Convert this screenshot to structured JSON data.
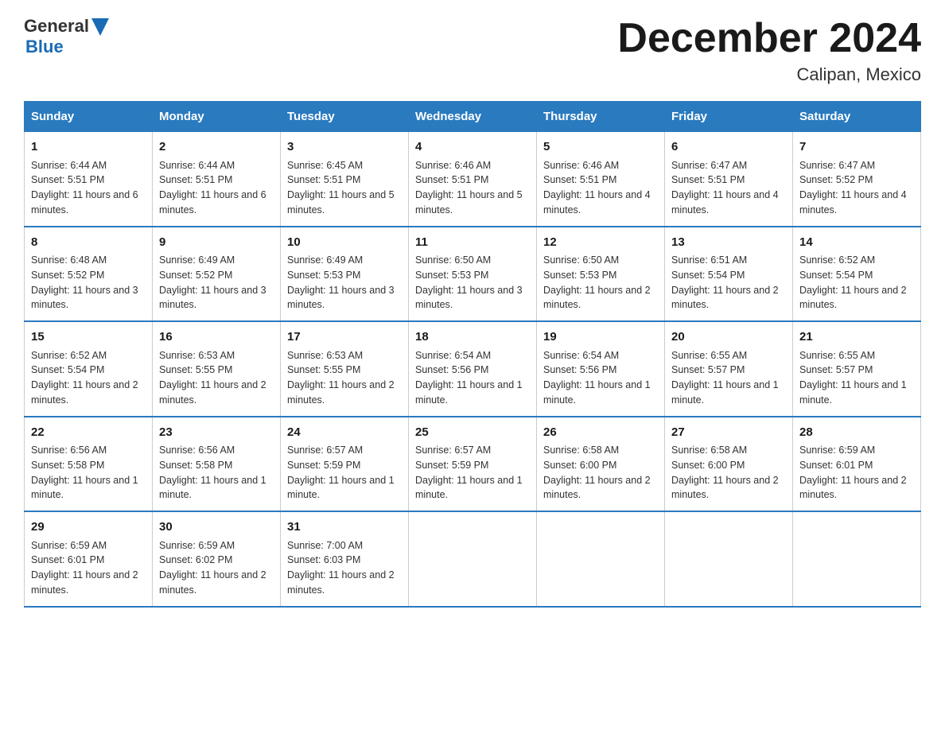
{
  "header": {
    "logo_general": "General",
    "logo_blue": "Blue",
    "month_title": "December 2024",
    "location": "Calipan, Mexico"
  },
  "calendar": {
    "days_of_week": [
      "Sunday",
      "Monday",
      "Tuesday",
      "Wednesday",
      "Thursday",
      "Friday",
      "Saturday"
    ],
    "weeks": [
      [
        {
          "day": "1",
          "sunrise": "Sunrise: 6:44 AM",
          "sunset": "Sunset: 5:51 PM",
          "daylight": "Daylight: 11 hours and 6 minutes."
        },
        {
          "day": "2",
          "sunrise": "Sunrise: 6:44 AM",
          "sunset": "Sunset: 5:51 PM",
          "daylight": "Daylight: 11 hours and 6 minutes."
        },
        {
          "day": "3",
          "sunrise": "Sunrise: 6:45 AM",
          "sunset": "Sunset: 5:51 PM",
          "daylight": "Daylight: 11 hours and 5 minutes."
        },
        {
          "day": "4",
          "sunrise": "Sunrise: 6:46 AM",
          "sunset": "Sunset: 5:51 PM",
          "daylight": "Daylight: 11 hours and 5 minutes."
        },
        {
          "day": "5",
          "sunrise": "Sunrise: 6:46 AM",
          "sunset": "Sunset: 5:51 PM",
          "daylight": "Daylight: 11 hours and 4 minutes."
        },
        {
          "day": "6",
          "sunrise": "Sunrise: 6:47 AM",
          "sunset": "Sunset: 5:51 PM",
          "daylight": "Daylight: 11 hours and 4 minutes."
        },
        {
          "day": "7",
          "sunrise": "Sunrise: 6:47 AM",
          "sunset": "Sunset: 5:52 PM",
          "daylight": "Daylight: 11 hours and 4 minutes."
        }
      ],
      [
        {
          "day": "8",
          "sunrise": "Sunrise: 6:48 AM",
          "sunset": "Sunset: 5:52 PM",
          "daylight": "Daylight: 11 hours and 3 minutes."
        },
        {
          "day": "9",
          "sunrise": "Sunrise: 6:49 AM",
          "sunset": "Sunset: 5:52 PM",
          "daylight": "Daylight: 11 hours and 3 minutes."
        },
        {
          "day": "10",
          "sunrise": "Sunrise: 6:49 AM",
          "sunset": "Sunset: 5:53 PM",
          "daylight": "Daylight: 11 hours and 3 minutes."
        },
        {
          "day": "11",
          "sunrise": "Sunrise: 6:50 AM",
          "sunset": "Sunset: 5:53 PM",
          "daylight": "Daylight: 11 hours and 3 minutes."
        },
        {
          "day": "12",
          "sunrise": "Sunrise: 6:50 AM",
          "sunset": "Sunset: 5:53 PM",
          "daylight": "Daylight: 11 hours and 2 minutes."
        },
        {
          "day": "13",
          "sunrise": "Sunrise: 6:51 AM",
          "sunset": "Sunset: 5:54 PM",
          "daylight": "Daylight: 11 hours and 2 minutes."
        },
        {
          "day": "14",
          "sunrise": "Sunrise: 6:52 AM",
          "sunset": "Sunset: 5:54 PM",
          "daylight": "Daylight: 11 hours and 2 minutes."
        }
      ],
      [
        {
          "day": "15",
          "sunrise": "Sunrise: 6:52 AM",
          "sunset": "Sunset: 5:54 PM",
          "daylight": "Daylight: 11 hours and 2 minutes."
        },
        {
          "day": "16",
          "sunrise": "Sunrise: 6:53 AM",
          "sunset": "Sunset: 5:55 PM",
          "daylight": "Daylight: 11 hours and 2 minutes."
        },
        {
          "day": "17",
          "sunrise": "Sunrise: 6:53 AM",
          "sunset": "Sunset: 5:55 PM",
          "daylight": "Daylight: 11 hours and 2 minutes."
        },
        {
          "day": "18",
          "sunrise": "Sunrise: 6:54 AM",
          "sunset": "Sunset: 5:56 PM",
          "daylight": "Daylight: 11 hours and 1 minute."
        },
        {
          "day": "19",
          "sunrise": "Sunrise: 6:54 AM",
          "sunset": "Sunset: 5:56 PM",
          "daylight": "Daylight: 11 hours and 1 minute."
        },
        {
          "day": "20",
          "sunrise": "Sunrise: 6:55 AM",
          "sunset": "Sunset: 5:57 PM",
          "daylight": "Daylight: 11 hours and 1 minute."
        },
        {
          "day": "21",
          "sunrise": "Sunrise: 6:55 AM",
          "sunset": "Sunset: 5:57 PM",
          "daylight": "Daylight: 11 hours and 1 minute."
        }
      ],
      [
        {
          "day": "22",
          "sunrise": "Sunrise: 6:56 AM",
          "sunset": "Sunset: 5:58 PM",
          "daylight": "Daylight: 11 hours and 1 minute."
        },
        {
          "day": "23",
          "sunrise": "Sunrise: 6:56 AM",
          "sunset": "Sunset: 5:58 PM",
          "daylight": "Daylight: 11 hours and 1 minute."
        },
        {
          "day": "24",
          "sunrise": "Sunrise: 6:57 AM",
          "sunset": "Sunset: 5:59 PM",
          "daylight": "Daylight: 11 hours and 1 minute."
        },
        {
          "day": "25",
          "sunrise": "Sunrise: 6:57 AM",
          "sunset": "Sunset: 5:59 PM",
          "daylight": "Daylight: 11 hours and 1 minute."
        },
        {
          "day": "26",
          "sunrise": "Sunrise: 6:58 AM",
          "sunset": "Sunset: 6:00 PM",
          "daylight": "Daylight: 11 hours and 2 minutes."
        },
        {
          "day": "27",
          "sunrise": "Sunrise: 6:58 AM",
          "sunset": "Sunset: 6:00 PM",
          "daylight": "Daylight: 11 hours and 2 minutes."
        },
        {
          "day": "28",
          "sunrise": "Sunrise: 6:59 AM",
          "sunset": "Sunset: 6:01 PM",
          "daylight": "Daylight: 11 hours and 2 minutes."
        }
      ],
      [
        {
          "day": "29",
          "sunrise": "Sunrise: 6:59 AM",
          "sunset": "Sunset: 6:01 PM",
          "daylight": "Daylight: 11 hours and 2 minutes."
        },
        {
          "day": "30",
          "sunrise": "Sunrise: 6:59 AM",
          "sunset": "Sunset: 6:02 PM",
          "daylight": "Daylight: 11 hours and 2 minutes."
        },
        {
          "day": "31",
          "sunrise": "Sunrise: 7:00 AM",
          "sunset": "Sunset: 6:03 PM",
          "daylight": "Daylight: 11 hours and 2 minutes."
        },
        {
          "day": "",
          "sunrise": "",
          "sunset": "",
          "daylight": ""
        },
        {
          "day": "",
          "sunrise": "",
          "sunset": "",
          "daylight": ""
        },
        {
          "day": "",
          "sunrise": "",
          "sunset": "",
          "daylight": ""
        },
        {
          "day": "",
          "sunrise": "",
          "sunset": "",
          "daylight": ""
        }
      ]
    ]
  }
}
